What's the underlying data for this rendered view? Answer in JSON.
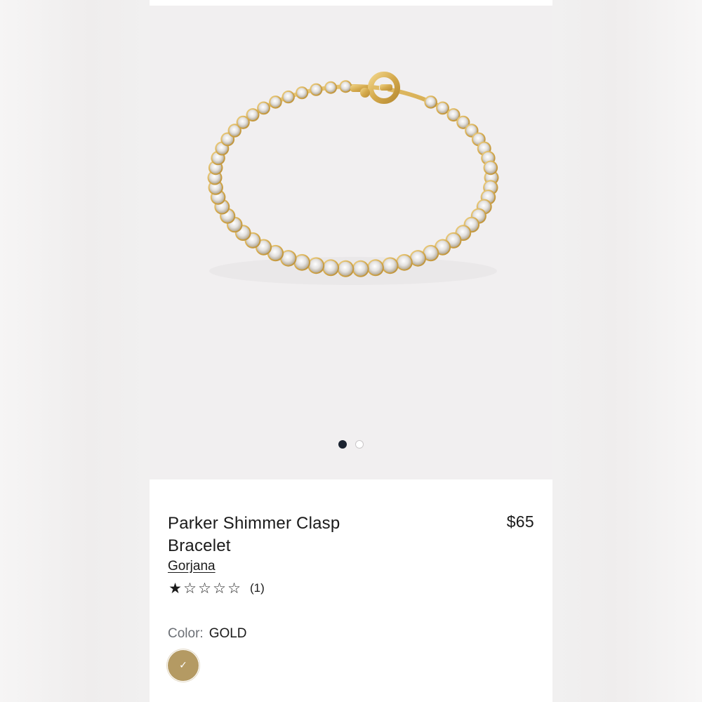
{
  "gallery": {
    "image_alt": "Parker Shimmer Clasp Bracelet product image",
    "slide_count": 2,
    "active_slide": 1
  },
  "product": {
    "title": "Parker Shimmer Clasp Bracelet",
    "price": "$65",
    "brand": "Gorjana",
    "rating": 1,
    "rating_max": 5,
    "review_count": "(1)",
    "stars": [
      "★",
      "☆",
      "☆",
      "☆",
      "☆"
    ]
  },
  "color": {
    "label": "Color:",
    "value": "GOLD",
    "swatch_hex": "#b49a63",
    "check": "✓"
  },
  "colors": {
    "gallery_bg": "#f1eff0",
    "active_dot": "#1b2330",
    "gold": "#d9b25a"
  }
}
